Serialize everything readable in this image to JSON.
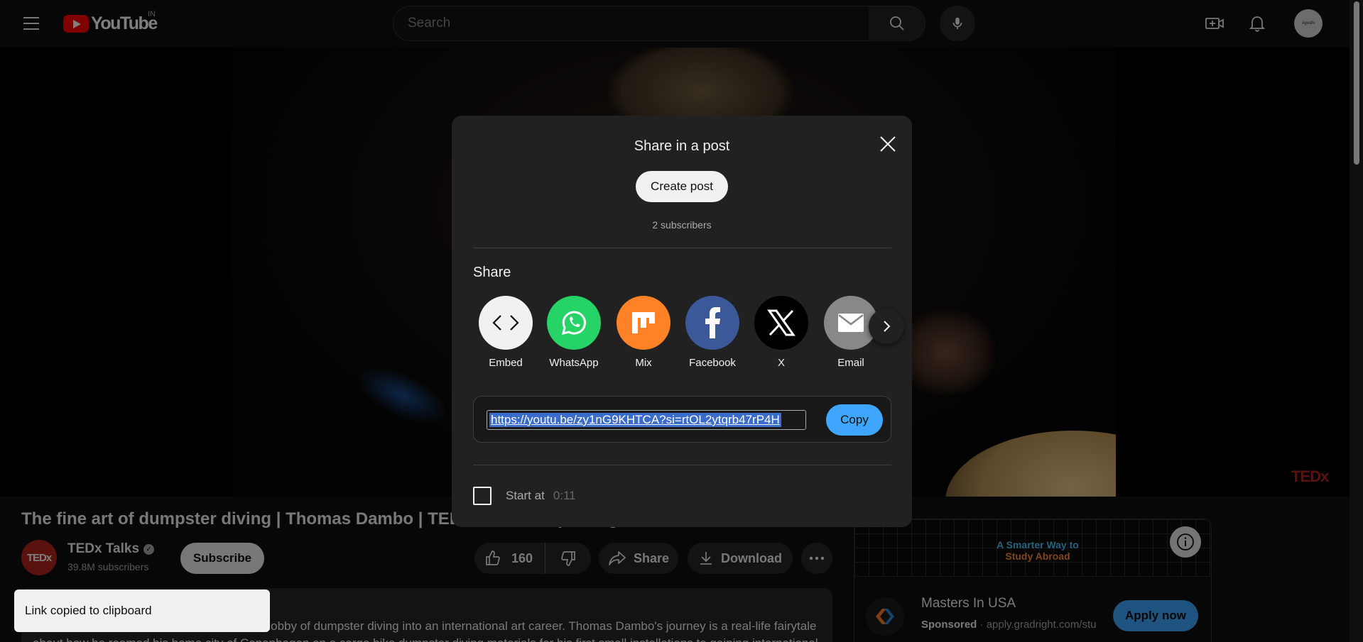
{
  "header": {
    "logo_text": "YouTube",
    "country_code": "IN",
    "search_placeholder": "Search",
    "icons": [
      "menu-icon",
      "search-icon",
      "mic-icon",
      "create-icon",
      "bell-icon"
    ],
    "avatar_text": "Ayushi"
  },
  "video": {
    "watermark": "TEDx",
    "title": "The fine art of dumpster diving | Thomas Dambo | TEDxYouth@Copenhagen",
    "channel": {
      "avatar_text": "TEDx",
      "name": "TEDx Talks",
      "subscribers": "39.8M subscribers",
      "subscribe_label": "Subscribe"
    },
    "actions": {
      "like_count": "160",
      "share_label": "Share",
      "download_label": "Download"
    },
    "description": "Artist Thomas Dambo turned his childhood hobby of dumpster diving into an international art career. Thomas Dambo's journey is a real-life fairytale about how he roamed his home city of Copenhagen on a cargo bike dumpster diving materials for his first small installations to gaining international recognition as"
  },
  "ad": {
    "banner_line1": "A Smarter Way to",
    "banner_line2": "Study Abroad",
    "title": "Masters In USA",
    "sponsored_label": "Sponsored",
    "separator": "·",
    "url": "apply.gradright.com/stu",
    "cta_label": "Apply now",
    "colors": {
      "cta": "#3ea6ff"
    }
  },
  "share_dialog": {
    "title": "Share in a post",
    "create_post_label": "Create post",
    "subscribers": "2 subscribers",
    "share_heading": "Share",
    "targets": [
      {
        "label": "Embed",
        "icon": "embed-icon",
        "color": "#f1f1f1"
      },
      {
        "label": "WhatsApp",
        "icon": "whatsapp-icon",
        "color": "#25d366"
      },
      {
        "label": "Mix",
        "icon": "mix-icon",
        "color": "#ff8226"
      },
      {
        "label": "Facebook",
        "icon": "facebook-icon",
        "color": "#3b5998"
      },
      {
        "label": "X",
        "icon": "x-icon",
        "color": "#000000"
      },
      {
        "label": "Email",
        "icon": "email-icon",
        "color": "#888888"
      }
    ],
    "link": "https://youtu.be/zy1nG9KHTCA?si=rtOL2ytqrb47rP4H",
    "copy_label": "Copy",
    "start_at_label": "Start at",
    "start_at_time": "0:11"
  },
  "toast": {
    "message": "Link copied to clipboard"
  }
}
